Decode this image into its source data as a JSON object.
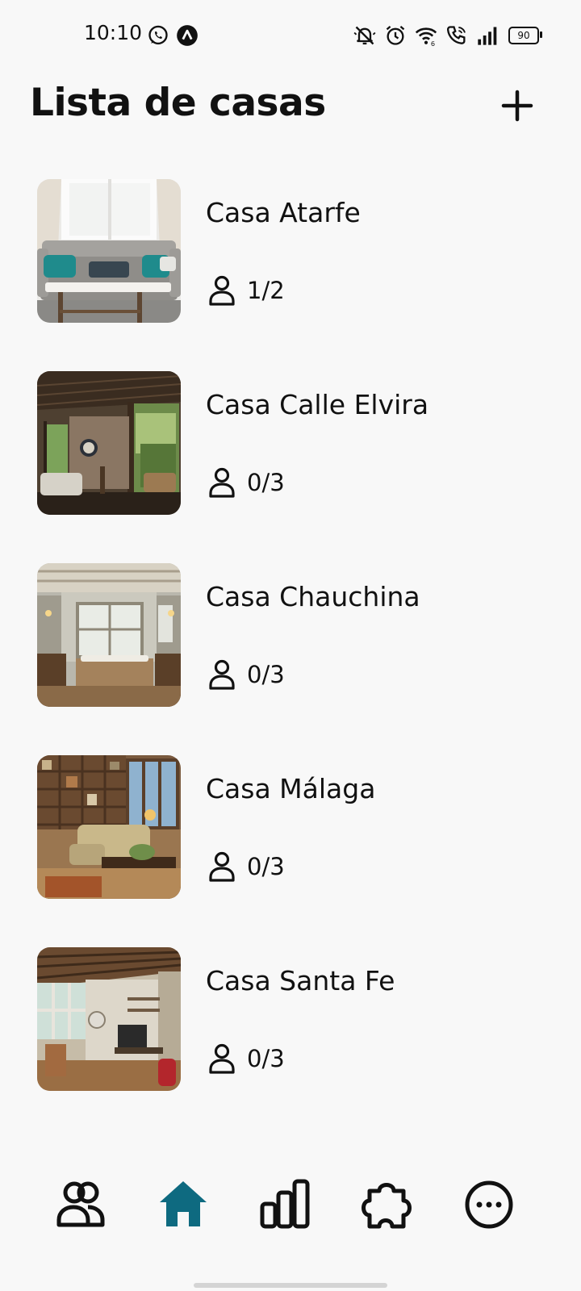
{
  "status_bar": {
    "time": "10:10",
    "left_icons": [
      "whatsapp-icon",
      "app-notification-icon"
    ],
    "right_icons": [
      "mute-icon",
      "alarm-icon",
      "wifi-icon",
      "wifi-calling-icon",
      "signal-icon"
    ],
    "battery": "90"
  },
  "header": {
    "title": "Lista de casas",
    "add_icon": "plus-icon"
  },
  "houses": [
    {
      "name": "Casa Atarfe",
      "occupancy": "1/2",
      "icon": "person-icon"
    },
    {
      "name": "Casa Calle Elvira",
      "occupancy": "0/3",
      "icon": "person-icon"
    },
    {
      "name": "Casa Chauchina",
      "occupancy": "0/3",
      "icon": "person-icon"
    },
    {
      "name": "Casa Málaga",
      "occupancy": "0/3",
      "icon": "person-icon"
    },
    {
      "name": "Casa Santa Fe",
      "occupancy": "0/3",
      "icon": "person-icon"
    }
  ],
  "bottom_nav": {
    "items": [
      {
        "icon": "users-icon",
        "active": false
      },
      {
        "icon": "home-icon",
        "active": true
      },
      {
        "icon": "chart-icon",
        "active": false
      },
      {
        "icon": "puzzle-icon",
        "active": false
      },
      {
        "icon": "more-icon",
        "active": false
      }
    ]
  },
  "colors": {
    "background": "#f8f8f8",
    "text": "#111111",
    "accent": "#0e6a80"
  }
}
